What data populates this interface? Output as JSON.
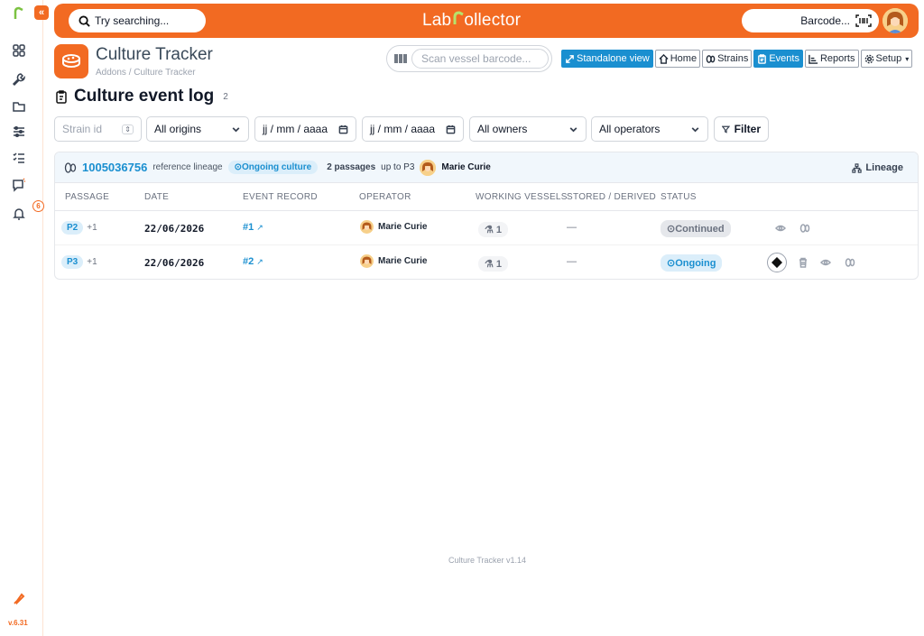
{
  "app": {
    "brand_prefix": "Lab",
    "brand_suffix": "ollector",
    "version": "v.6.31",
    "footer": "Culture Tracker v1.14",
    "accent": "#f26a22",
    "link_color": "#1a8fd0"
  },
  "topbar": {
    "search_placeholder": "Try searching...",
    "barcode_label": "Barcode..."
  },
  "sidebar": {
    "items": [
      {
        "icon": "grid-icon"
      },
      {
        "icon": "wrench-icon"
      },
      {
        "icon": "folder-icon"
      },
      {
        "icon": "sliders-icon"
      },
      {
        "icon": "checklist-icon"
      },
      {
        "icon": "message-icon"
      },
      {
        "icon": "bell-icon",
        "badge": "6"
      }
    ],
    "bottom_icon": "rocket-icon"
  },
  "header": {
    "title": "Culture Tracker",
    "breadcrumb": "Addons / Culture Tracker",
    "scan_placeholder": "Scan vessel barcode..."
  },
  "nav": {
    "standalone": "Standalone view",
    "home": "Home",
    "strains": "Strains",
    "events": "Events",
    "reports": "Reports",
    "setup": "Setup"
  },
  "page": {
    "title": "Culture event log",
    "count": "2"
  },
  "filters": {
    "strain_placeholder": "Strain id",
    "origins": "All origins",
    "date_from": "jj / mm / aaaa",
    "date_to": "jj / mm / aaaa",
    "owners": "All owners",
    "operators": "All operators",
    "filter_button": "Filter"
  },
  "lineage_card": {
    "strain_id": "1005036756",
    "reference": "reference lineage",
    "status": "Ongoing culture",
    "passages": "2 passages",
    "up_to": "up to P3",
    "operator": "Marie Curie",
    "lineage_button": "Lineage"
  },
  "table": {
    "columns": [
      "PASSAGE",
      "DATE",
      "EVENT RECORD",
      "OPERATOR",
      "WORKING VESSELS",
      "STORED / DERIVED",
      "STATUS"
    ],
    "rows": [
      {
        "passage": "P2",
        "extra": "+1",
        "date": "22/06/2026",
        "record": "#1",
        "operator": "Marie Curie",
        "vessels": "1",
        "stored": "—",
        "status": "Continued"
      },
      {
        "passage": "P3",
        "extra": "+1",
        "date": "22/06/2026",
        "record": "#2",
        "operator": "Marie Curie",
        "vessels": "1",
        "stored": "—",
        "status": "Ongoing"
      }
    ]
  }
}
